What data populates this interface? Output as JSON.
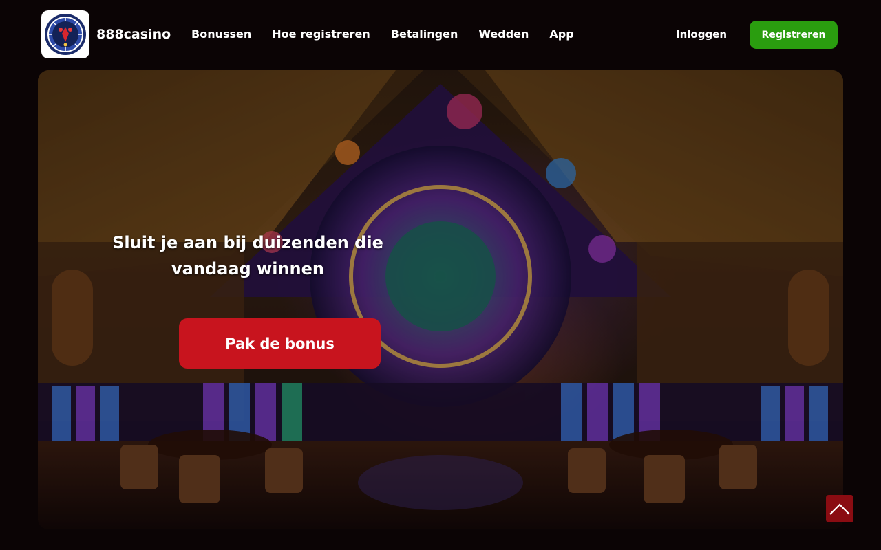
{
  "header": {
    "brand": "888casino",
    "nav": [
      {
        "label": "Bonussen"
      },
      {
        "label": "Hoe registreren"
      },
      {
        "label": "Betalingen"
      },
      {
        "label": "Wedden"
      },
      {
        "label": "App"
      }
    ],
    "login_label": "Inloggen",
    "register_label": "Registreren"
  },
  "hero": {
    "title": "Sluit je aan bij duizenden die vandaag winnen",
    "cta_label": "Pak de bonus"
  },
  "colors": {
    "register": "#2a9d0f",
    "cta": "#c8141e",
    "scroll_top": "#8a0c12",
    "background": "#0b0405"
  },
  "icons": {
    "logo": "casino-emblem-icon",
    "scroll_top": "chevron-up-icon"
  }
}
